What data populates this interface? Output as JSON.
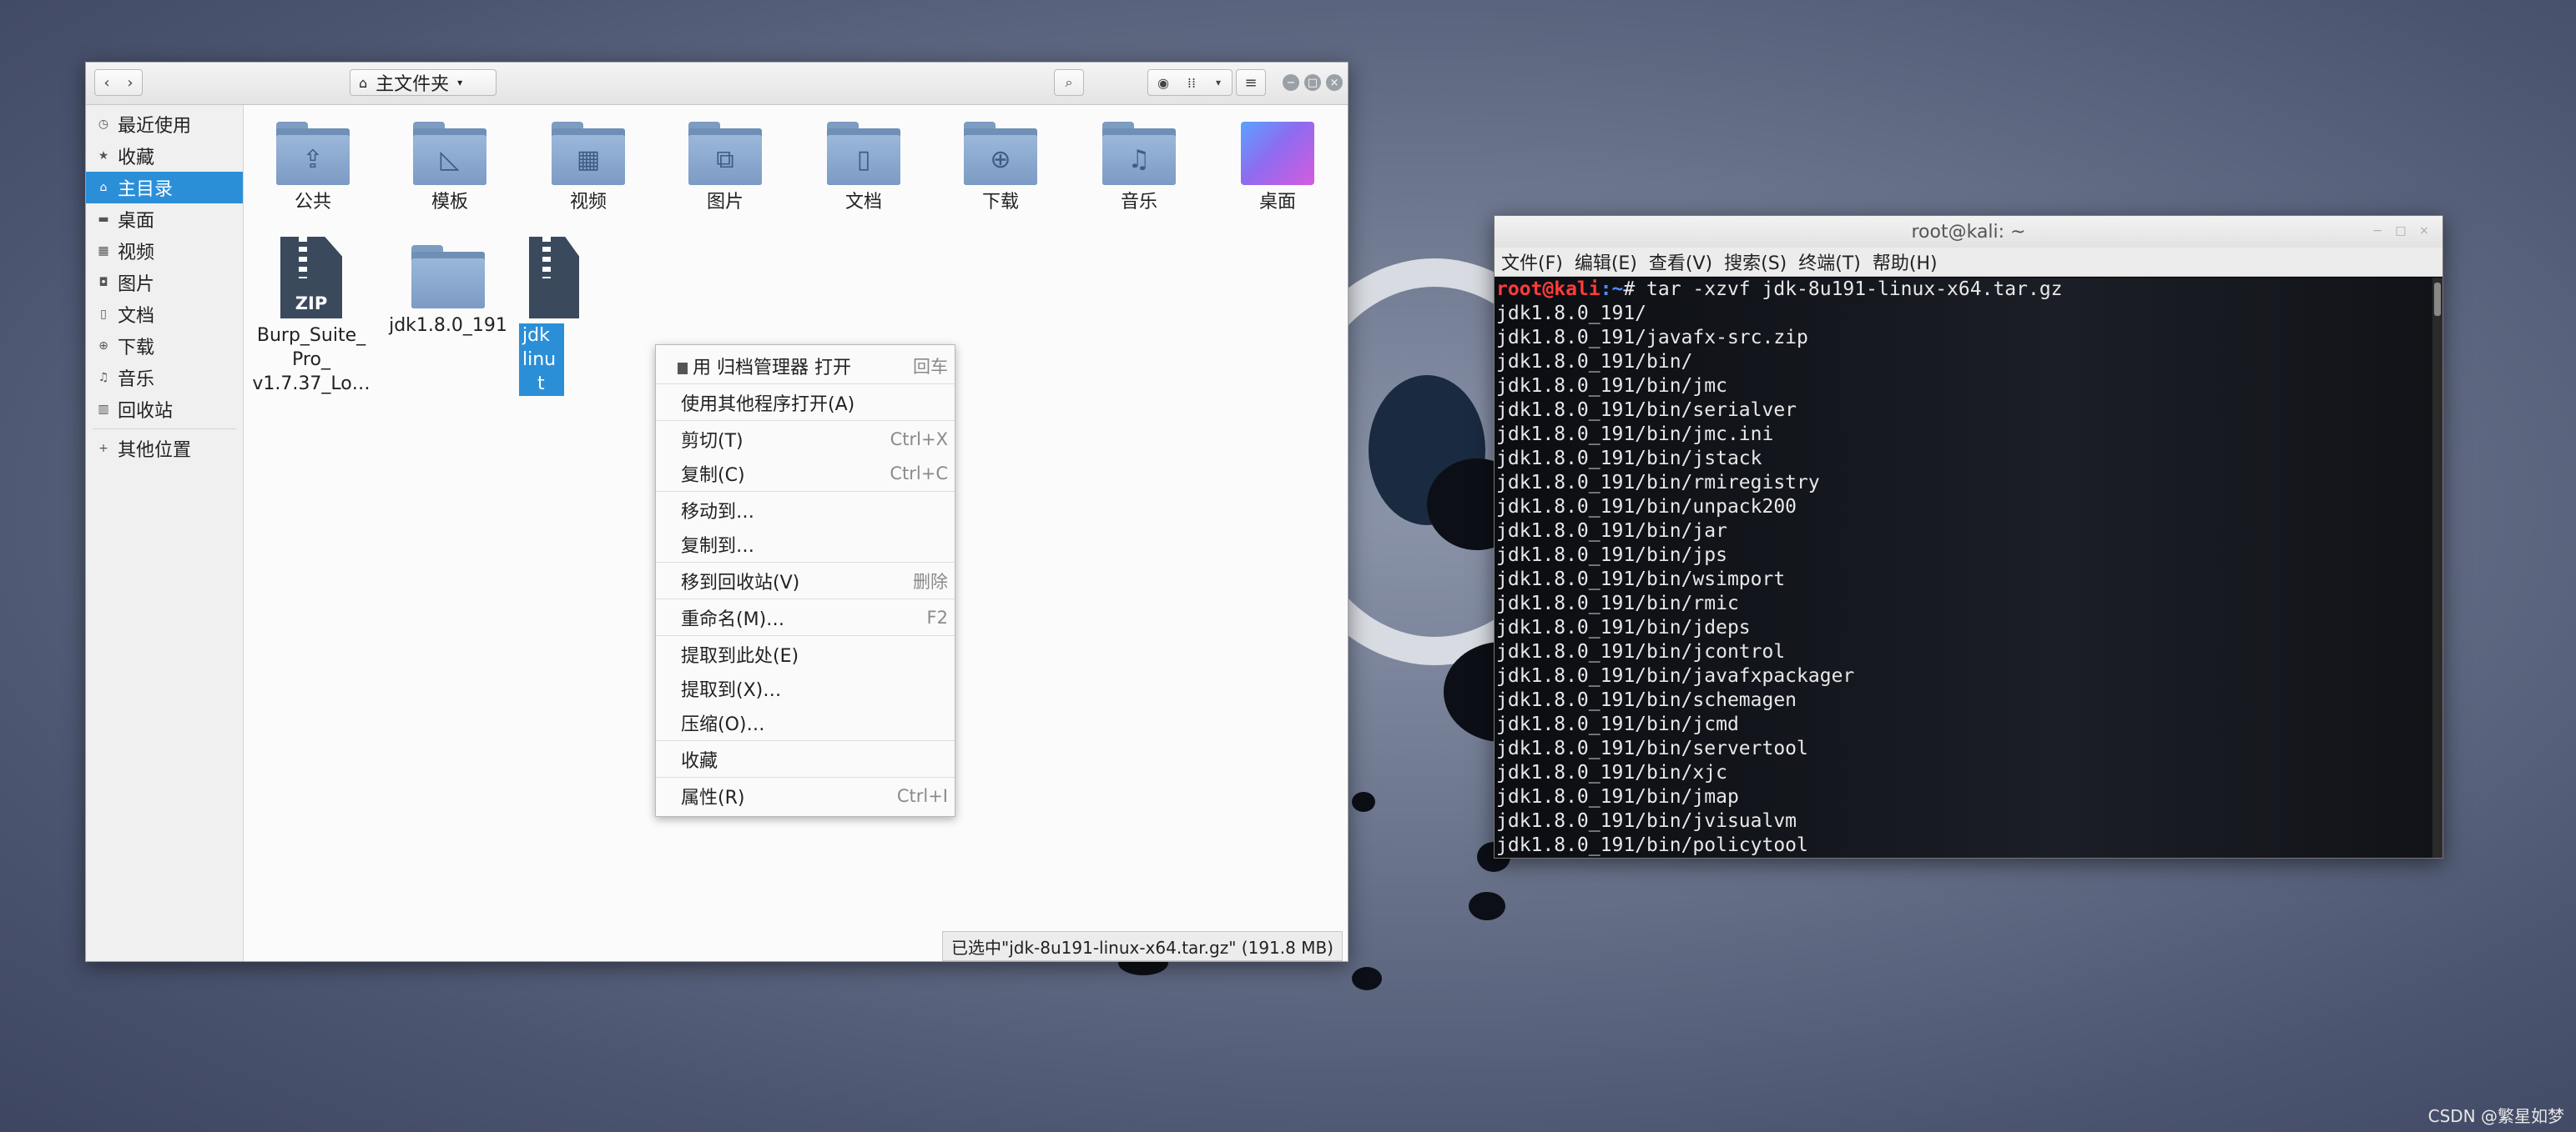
{
  "file_manager": {
    "path_label": "主文件夹",
    "sidebar": [
      {
        "icon": "clock-icon",
        "glyph": "◷",
        "label": "最近使用",
        "active": false
      },
      {
        "icon": "star-icon",
        "glyph": "★",
        "label": "收藏",
        "active": false
      },
      {
        "icon": "home-icon",
        "glyph": "⌂",
        "label": "主目录",
        "active": true
      },
      {
        "icon": "desktop-icon",
        "glyph": "▬",
        "label": "桌面",
        "active": false
      },
      {
        "icon": "video-icon",
        "glyph": "▦",
        "label": "视频",
        "active": false
      },
      {
        "icon": "picture-icon",
        "glyph": "◘",
        "label": "图片",
        "active": false
      },
      {
        "icon": "document-icon",
        "glyph": "▯",
        "label": "文档",
        "active": false
      },
      {
        "icon": "download-icon",
        "glyph": "⊕",
        "label": "下载",
        "active": false
      },
      {
        "icon": "music-icon",
        "glyph": "♫",
        "label": "音乐",
        "active": false
      },
      {
        "icon": "trash-icon",
        "glyph": "▥",
        "label": "回收站",
        "active": false
      }
    ],
    "sidebar_other": {
      "glyph": "+",
      "label": "其他位置"
    },
    "items": [
      {
        "label": "公共",
        "glyph": "⇪"
      },
      {
        "label": "模板",
        "glyph": "◺"
      },
      {
        "label": "视频",
        "glyph": "▦"
      },
      {
        "label": "图片",
        "glyph": "⧉"
      },
      {
        "label": "文档",
        "glyph": "▯"
      },
      {
        "label": "下载",
        "glyph": "⊕"
      },
      {
        "label": "音乐",
        "glyph": "♫"
      },
      {
        "label": "桌面",
        "glyph": ""
      }
    ],
    "row2": {
      "zip_label_1": "Burp_Suite_",
      "zip_label_2": "Pro_",
      "zip_label_3": "v1.7.37_Lo…",
      "zip_text": "ZIP",
      "folder_label": "jdk1.8.0_191",
      "selected_label_1": "jdk",
      "selected_label_2": "linu",
      "selected_label_3": "t"
    },
    "status": "已选中\"jdk-8u191-linux-x64.tar.gz\" (191.8 MB)",
    "context_menu": [
      {
        "label": "用 归档管理器 打开",
        "shortcut": "回车",
        "sep_after": true
      },
      {
        "label": "使用其他程序打开(A)",
        "shortcut": "",
        "sep_after": true
      },
      {
        "label": "剪切(T)",
        "shortcut": "Ctrl+X",
        "sep_after": false
      },
      {
        "label": "复制(C)",
        "shortcut": "Ctrl+C",
        "sep_after": true
      },
      {
        "label": "移动到…",
        "shortcut": "",
        "sep_after": false
      },
      {
        "label": "复制到…",
        "shortcut": "",
        "sep_after": true
      },
      {
        "label": "移到回收站(V)",
        "shortcut": "删除",
        "sep_after": true
      },
      {
        "label": "重命名(M)…",
        "shortcut": "F2",
        "sep_after": true
      },
      {
        "label": "提取到此处(E)",
        "shortcut": "",
        "sep_after": false
      },
      {
        "label": "提取到(X)…",
        "shortcut": "",
        "sep_after": false
      },
      {
        "label": "压缩(O)…",
        "shortcut": "",
        "sep_after": true
      },
      {
        "label": "收藏",
        "shortcut": "",
        "sep_after": true
      },
      {
        "label": "属性(R)",
        "shortcut": "Ctrl+I",
        "sep_after": false
      }
    ]
  },
  "terminal": {
    "title": "root@kali: ~",
    "menu": [
      "文件(F)",
      "编辑(E)",
      "查看(V)",
      "搜索(S)",
      "终端(T)",
      "帮助(H)"
    ],
    "prompt_user": "root@kali",
    "prompt_path": ":~",
    "prompt_symbol": "# ",
    "command": "tar -xzvf jdk-8u191-linux-x64.tar.gz",
    "lines": [
      "jdk1.8.0_191/",
      "jdk1.8.0_191/javafx-src.zip",
      "jdk1.8.0_191/bin/",
      "jdk1.8.0_191/bin/jmc",
      "jdk1.8.0_191/bin/serialver",
      "jdk1.8.0_191/bin/jmc.ini",
      "jdk1.8.0_191/bin/jstack",
      "jdk1.8.0_191/bin/rmiregistry",
      "jdk1.8.0_191/bin/unpack200",
      "jdk1.8.0_191/bin/jar",
      "jdk1.8.0_191/bin/jps",
      "jdk1.8.0_191/bin/wsimport",
      "jdk1.8.0_191/bin/rmic",
      "jdk1.8.0_191/bin/jdeps",
      "jdk1.8.0_191/bin/jcontrol",
      "jdk1.8.0_191/bin/javafxpackager",
      "jdk1.8.0_191/bin/schemagen",
      "jdk1.8.0_191/bin/jcmd",
      "jdk1.8.0_191/bin/servertool",
      "jdk1.8.0_191/bin/xjc",
      "jdk1.8.0_191/bin/jmap",
      "jdk1.8.0_191/bin/jvisualvm",
      "jdk1.8.0_191/bin/policytool"
    ]
  },
  "watermark": "CSDN @繁星如梦"
}
